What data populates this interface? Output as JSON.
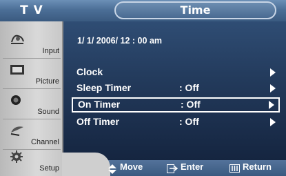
{
  "header": {
    "brand": "T V",
    "title": "Time"
  },
  "sidebar": {
    "items": [
      {
        "label": "Input",
        "icon": "input-icon"
      },
      {
        "label": "Picture",
        "icon": "picture-icon"
      },
      {
        "label": "Sound",
        "icon": "sound-icon"
      },
      {
        "label": "Channel",
        "icon": "channel-icon"
      },
      {
        "label": "Setup",
        "icon": "setup-icon"
      }
    ]
  },
  "main": {
    "datetime": "1/ 1/ 2006/ 12 : 00  am",
    "rows": [
      {
        "label": "Clock",
        "value": ""
      },
      {
        "label": "Sleep Timer",
        "value": ": Off"
      },
      {
        "label": "On Timer",
        "value": ": Off"
      },
      {
        "label": "Off Timer",
        "value": ": Off"
      }
    ],
    "selected_row": "On Timer"
  },
  "footer": {
    "move": "Move",
    "enter": "Enter",
    "return": "Return"
  },
  "colors": {
    "accent": "#3a5a80",
    "sidebar": "#cfcfcf",
    "text": "#ffffff"
  }
}
